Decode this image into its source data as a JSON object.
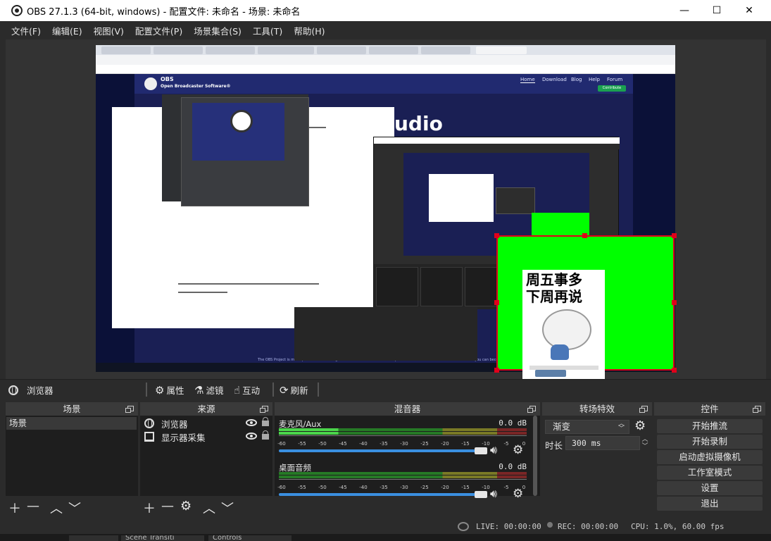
{
  "window": {
    "title": "OBS 27.1.3 (64-bit, windows) - 配置文件: 未命名 - 场景: 未命名",
    "controls": {
      "minimize": "—",
      "maximize": "☐",
      "close": "✕"
    }
  },
  "menu": [
    "文件(F)",
    "编辑(E)",
    "视图(V)",
    "配置文件(P)",
    "场景集合(S)",
    "工具(T)",
    "帮助(H)"
  ],
  "preview": {
    "website": {
      "brand": "OBS",
      "brand_sub": "Open Broadcaster Software®",
      "nav": [
        "Home",
        "Download",
        "Blog",
        "Help",
        "Forum"
      ],
      "contribute": "Contribute",
      "headline": "udio",
      "footnote": "The OBS Project is made possible thanks to generous contributions from our sponsors and backers. Learn more about how you can become a sponsor."
    },
    "sticker_text": [
      "周五事多",
      "下周再说"
    ]
  },
  "source_toolbar": {
    "selected_source": "浏览器",
    "buttons": [
      "属性",
      "滤镜",
      "互动",
      "刷新"
    ]
  },
  "docks": {
    "scenes": {
      "title": "场景",
      "items": [
        "场景"
      ]
    },
    "sources": {
      "title": "来源",
      "items": [
        {
          "name": "浏览器",
          "icon": "globe-icon"
        },
        {
          "name": "显示器采集",
          "icon": "monitor-icon"
        }
      ]
    },
    "mixer": {
      "title": "混音器",
      "channels": [
        {
          "name": "麦克风/Aux",
          "level": "0.0 dB"
        },
        {
          "name": "桌面音频",
          "level": "0.0 dB"
        }
      ],
      "scale": [
        "-60",
        "-55",
        "-50",
        "-45",
        "-40",
        "-35",
        "-30",
        "-25",
        "-20",
        "-15",
        "-10",
        "-5",
        "0"
      ]
    },
    "transitions": {
      "title": "转场特效",
      "type": "渐变",
      "duration_label": "时长",
      "duration": "300 ms"
    },
    "controls": {
      "title": "控件",
      "buttons": [
        "开始推流",
        "开始录制",
        "启动虚拟摄像机",
        "工作室模式",
        "设置",
        "退出"
      ]
    }
  },
  "status": {
    "live": "LIVE: 00:00:00",
    "rec": "REC: 00:00:00",
    "cpu": "CPU: 1.0%, 60.00 fps"
  },
  "bottom_tabs": [
    "Scene Transiti",
    "Controls"
  ]
}
